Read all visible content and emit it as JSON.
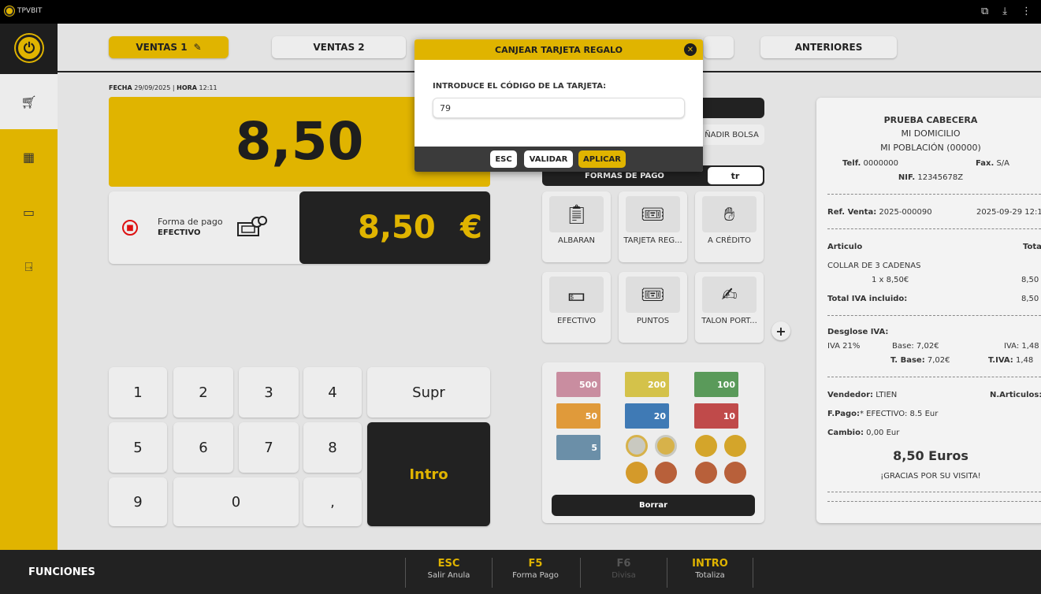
{
  "app": {
    "title": "TPVBIT"
  },
  "tabs": [
    {
      "label": "VENTAS 1",
      "active": true
    },
    {
      "label": "VENTAS 2",
      "active": false
    },
    {
      "label": "ANTERIORES",
      "active": false
    }
  ],
  "date": {
    "fecha_label": "FECHA",
    "fecha": "29/09/2025",
    "hora_label": "HORA",
    "hora": "12:11"
  },
  "total": {
    "value": "8,50"
  },
  "payment": {
    "label": "Forma de pago",
    "method": "EFECTIVO",
    "amount": "8,50",
    "currency": "€"
  },
  "keypad": {
    "keys": [
      "1",
      "2",
      "3",
      "4",
      "5",
      "6",
      "7",
      "8",
      "9",
      "0",
      ","
    ],
    "supr": "Supr",
    "intro": "Intro"
  },
  "right": {
    "add_bag": "ÑADIR BOLSA",
    "formas_title": "FORMAS DE PAGO",
    "formas_toggle": "tr",
    "methods": [
      {
        "label": "ALBARAN",
        "icon": "clipboard-icon"
      },
      {
        "label": "TARJETA REG...",
        "icon": "gift-card-icon"
      },
      {
        "label": "A CRÉDITO",
        "icon": "credit-hand-icon"
      },
      {
        "label": "EFECTIVO",
        "icon": "cash-icon"
      },
      {
        "label": "PUNTOS",
        "icon": "gift-card-icon"
      },
      {
        "label": "TALON PORT...",
        "icon": "cheque-icon"
      }
    ],
    "plus": "+",
    "borrar": "Borrar",
    "notes": [
      "500",
      "200",
      "100",
      "50",
      "20",
      "10",
      "5"
    ]
  },
  "ticket": {
    "header1": "PRUEBA CABECERA",
    "header2": "MI DOMICILIO",
    "header3": "MI POBLACIÓN (00000)",
    "telf_label": "Telf.",
    "telf": "0000000",
    "fax_label": "Fax.",
    "fax": "S/A",
    "nif_label": "NIF.",
    "nif": "12345678Z",
    "ref_label": "Ref. Venta:",
    "ref": "2025-000090",
    "ref_date": "2025-09-29 12:1",
    "articulo_label": "Articulo",
    "total_label": "Tota",
    "item_name": "COLLAR DE 3 CADENAS",
    "item_qty": "1 x 8,50€",
    "item_total": "8,50",
    "iva_incl_label": "Total IVA incluido:",
    "iva_incl": "8,50",
    "desglose_label": "Desglose IVA:",
    "iva_rate": "IVA 21%",
    "base_label": "Base:",
    "base": "7,02€",
    "iva_label": "IVA:",
    "iva": "1,48",
    "tbase_label": "T. Base:",
    "tbase": "7,02€",
    "tiva_label": "T.IVA:",
    "tiva": "1,48",
    "vendedor_label": "Vendedor:",
    "vendedor": "LTIEN",
    "narticulos_label": "N.Articulos:",
    "fpago_label": "F.Pago:",
    "fpago": "* EFECTIVO: 8.5 Eur",
    "cambio_label": "Cambio:",
    "cambio": "0,00 Eur",
    "total_euros": "8,50 Euros",
    "thanks": "¡GRACIAS POR SU VISITA!"
  },
  "bottom": {
    "funciones": "FUNCIONES",
    "keys": [
      {
        "k": "ESC",
        "d": "Salir Anula"
      },
      {
        "k": "F5",
        "d": "Forma Pago"
      },
      {
        "k": "F6",
        "d": "Divisa"
      },
      {
        "k": "INTRO",
        "d": "Totaliza"
      }
    ]
  },
  "modal": {
    "title": "CANJEAR TARJETA REGALO",
    "prompt": "INTRODUCE EL CÓDIGO DE LA TARJETA:",
    "input_value": "79",
    "esc": "ESC",
    "validar": "VALIDAR",
    "aplicar": "APLICAR"
  }
}
